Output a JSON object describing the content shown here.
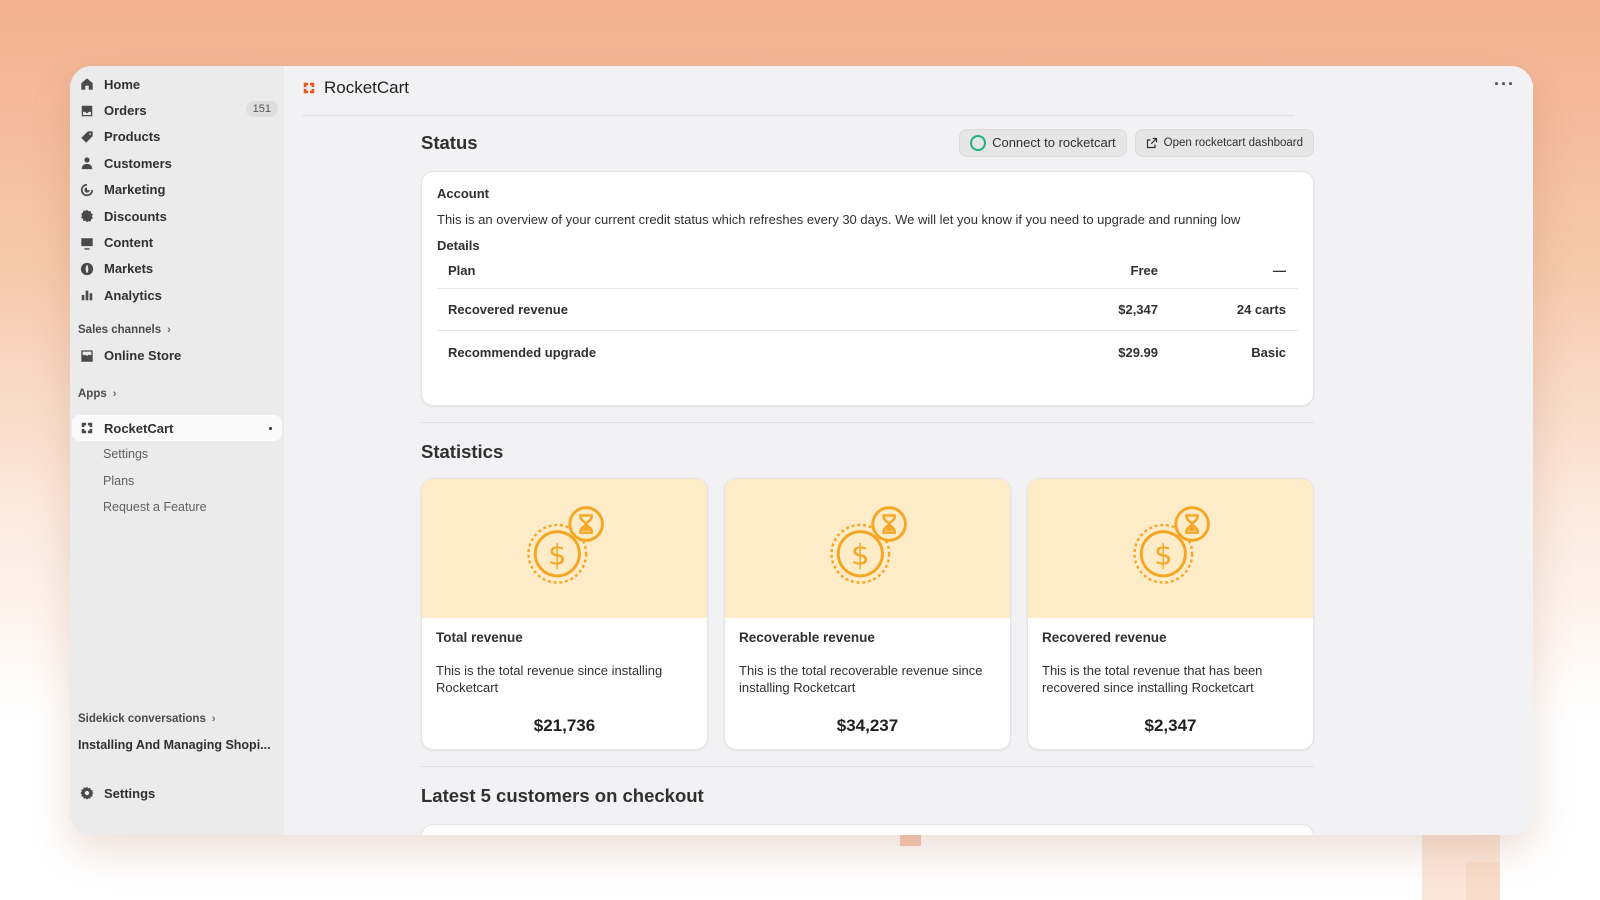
{
  "sidebar": {
    "items": [
      {
        "label": "Home",
        "icon": "home-icon"
      },
      {
        "label": "Orders",
        "icon": "inbox-icon",
        "badge": "151"
      },
      {
        "label": "Products",
        "icon": "tag-icon"
      },
      {
        "label": "Customers",
        "icon": "person-icon"
      },
      {
        "label": "Marketing",
        "icon": "target-icon"
      },
      {
        "label": "Discounts",
        "icon": "discount-icon"
      },
      {
        "label": "Content",
        "icon": "image-icon"
      },
      {
        "label": "Markets",
        "icon": "globe-icon"
      },
      {
        "label": "Analytics",
        "icon": "bar-chart-icon"
      }
    ],
    "sales_channels_label": "Sales channels",
    "online_store_label": "Online Store",
    "apps_label": "Apps",
    "app_label": "RocketCart",
    "app_subitems": [
      "Settings",
      "Plans",
      "Request a Feature"
    ],
    "sidekick_label": "Sidekick conversations",
    "conversation_label": "Installing And Managing Shopi...",
    "settings_label": "Settings"
  },
  "header": {
    "title": "RocketCart",
    "more_label": "···"
  },
  "status": {
    "title": "Status",
    "connect_button": "Connect to rocketcart",
    "dashboard_button": "Open rocketcart dashboard",
    "account_label": "Account",
    "account_desc": "This is an overview of your current credit status which refreshes every 30 days. We will let you know if you need to upgrade and running low",
    "details_label": "Details",
    "rows": [
      {
        "label": "Plan",
        "value": "Free",
        "extra": "—"
      },
      {
        "label": "Recovered revenue",
        "value": "$2,347",
        "extra": "24 carts"
      },
      {
        "label": "Recommended upgrade",
        "value": "$29.99",
        "extra": "Basic"
      }
    ]
  },
  "statistics": {
    "title": "Statistics",
    "cards": [
      {
        "title": "Total revenue",
        "desc": "This is the total revenue since installing Rocketcart",
        "value": "$21,736"
      },
      {
        "title": "Recoverable revenue",
        "desc": "This is the total recoverable revenue since installing Rocketcart",
        "value": "$34,237"
      },
      {
        "title": "Recovered revenue",
        "desc": "This is the total revenue that has been recovered since installing Rocketcart",
        "value": "$2,347"
      }
    ]
  },
  "latest": {
    "title": "Latest 5 customers on checkout"
  },
  "colors": {
    "accent_green": "#1db479",
    "illustration_orange": "#f5a623",
    "illustration_bg": "#feebc8",
    "logo_orange": "#e8562a"
  }
}
